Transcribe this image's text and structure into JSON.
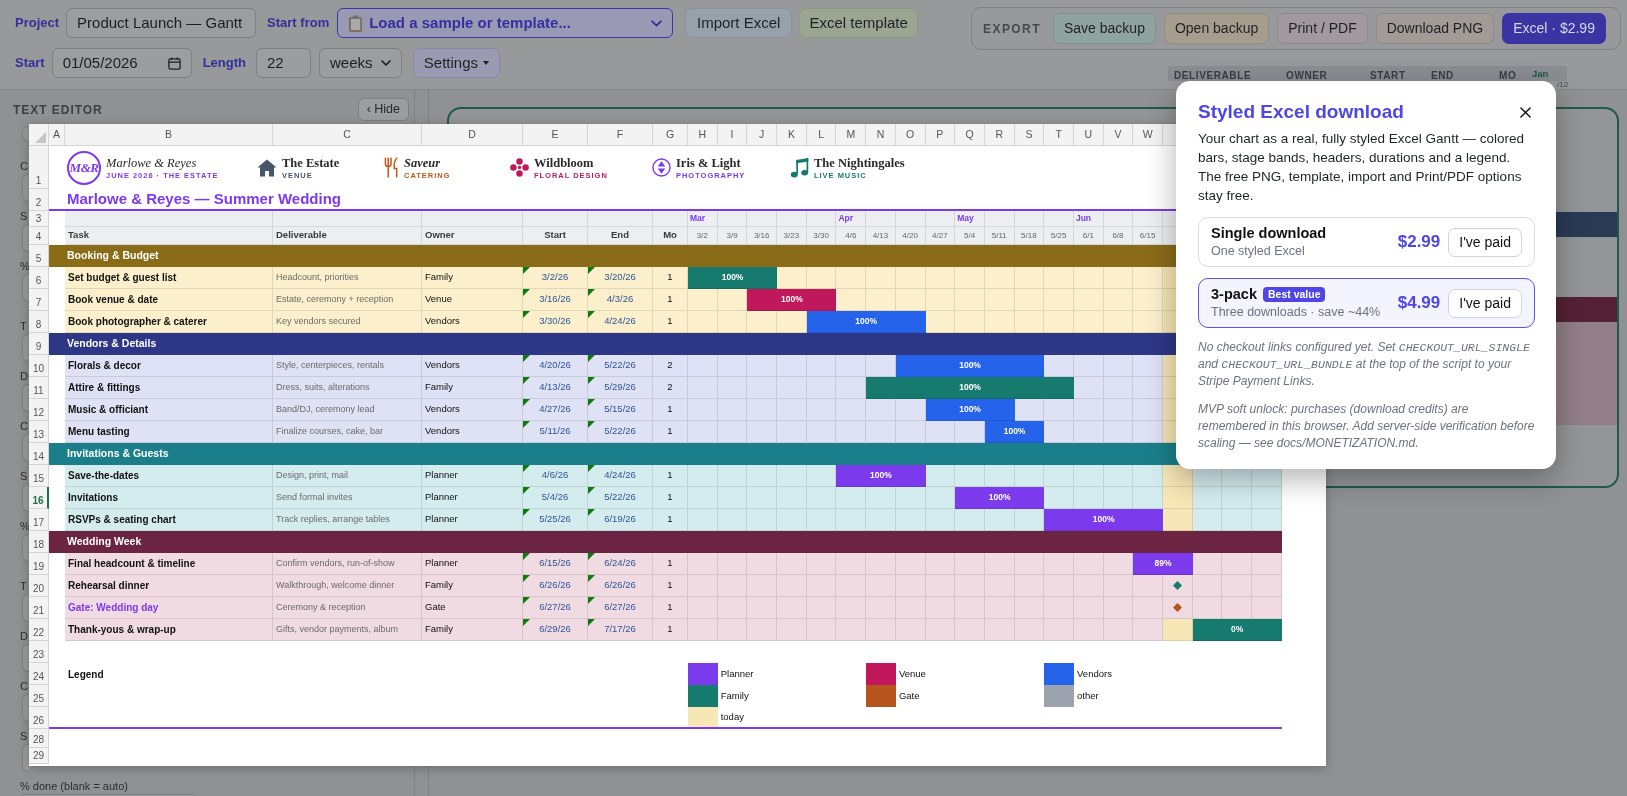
{
  "topbar": {
    "project_label": "Project",
    "project_name": "Product Launch — Gantt",
    "start_from_label": "Start from",
    "template_select": "Load a sample or template...",
    "import_button": "Import Excel",
    "template_button": "Excel template",
    "start_label": "Start",
    "start_date": "01/05/2026",
    "length_label": "Length",
    "length": "22",
    "unit": "weeks",
    "settings_button": "Settings"
  },
  "export": {
    "label": "EXPORT",
    "buttons": [
      {
        "label": "Save backup",
        "kind": "tint",
        "color": "#8fa4a0"
      },
      {
        "label": "Open backup",
        "kind": "tint",
        "color": "#a59e8f"
      },
      {
        "label": "Print / PDF",
        "kind": "tint",
        "color": "#a2999f"
      },
      {
        "label": "Download PNG",
        "kind": "tint",
        "color": "#a29a97"
      },
      {
        "label": "Excel · $2.99",
        "kind": "primary",
        "color": "#3b35a3"
      }
    ]
  },
  "editor": {
    "title": "TEXT EDITOR",
    "hide_button": "‹ Hide",
    "cards": [
      {
        "fields": [
          {
            "label": "C"
          },
          {
            "label": "S"
          },
          {
            "label": "%"
          }
        ]
      },
      {
        "fields": [
          {
            "label": "T"
          },
          {
            "label": "D"
          },
          {
            "label": "C"
          },
          {
            "label": "S"
          },
          {
            "label": "%"
          }
        ]
      },
      {
        "fields": [
          {
            "label": "T"
          },
          {
            "label": "D"
          },
          {
            "label": "C"
          },
          {
            "label": "S"
          },
          {
            "label": "% done (blank = auto)"
          }
        ]
      }
    ]
  },
  "table_header": {
    "columns": [
      "DELIVERABLE",
      "OWNER",
      "START",
      "END",
      "MO"
    ],
    "month": "Jan",
    "week": "/12"
  },
  "sheet": {
    "column_letters": [
      "A",
      "B",
      "C",
      "D",
      "E",
      "F",
      "G",
      "H",
      "I",
      "J",
      "K",
      "L",
      "M",
      "N",
      "O",
      "P",
      "Q",
      "R",
      "S",
      "T",
      "U",
      "V",
      "W"
    ],
    "row_numbers": [
      {
        "label": "1",
        "selected": false
      },
      {
        "label": "2",
        "selected": false
      },
      {
        "label": "3",
        "selected": false
      },
      {
        "label": "4",
        "selected": false
      },
      {
        "label": "5",
        "selected": false
      },
      {
        "label": "6",
        "selected": false
      },
      {
        "label": "7",
        "selected": false
      },
      {
        "label": "8",
        "selected": false
      },
      {
        "label": "9",
        "selected": false
      },
      {
        "label": "10",
        "selected": false
      },
      {
        "label": "11",
        "selected": false
      },
      {
        "label": "12",
        "selected": false
      },
      {
        "label": "13",
        "selected": false
      },
      {
        "label": "14",
        "selected": false
      },
      {
        "label": "15",
        "selected": false
      },
      {
        "label": "16",
        "selected": true
      },
      {
        "label": "17",
        "selected": false
      },
      {
        "label": "18",
        "selected": false
      },
      {
        "label": "19",
        "selected": false
      },
      {
        "label": "20",
        "selected": false
      },
      {
        "label": "21",
        "selected": false
      },
      {
        "label": "22",
        "selected": false
      },
      {
        "label": "23",
        "selected": false
      },
      {
        "label": "24",
        "selected": false
      },
      {
        "label": "25",
        "selected": false
      },
      {
        "label": "26",
        "selected": false
      },
      {
        "label": "28",
        "selected": false
      },
      {
        "label": "29",
        "selected": false
      }
    ],
    "logos": [
      {
        "kind": "monogram",
        "mark": "M&R",
        "name": "Marlowe & Reyes",
        "tagline": "JUNE 2026 · THE ESTATE",
        "color": "#7c3aed"
      },
      {
        "kind": "house",
        "name": "The Estate",
        "tagline": "VENUE",
        "color": "#475569"
      },
      {
        "kind": "cutlery",
        "name": "Saveur",
        "tagline": "CATERING",
        "color": "#c2571a"
      },
      {
        "kind": "flower",
        "name": "Wildbloom",
        "tagline": "FLORAL DESIGN",
        "color": "#c0185a"
      },
      {
        "kind": "aperture",
        "name": "Iris & Light",
        "tagline": "PHOTOGRAPHY",
        "color": "#7c3aed"
      },
      {
        "kind": "music",
        "name": "The Nightingales",
        "tagline": "LIVE MUSIC",
        "color": "#177a6e"
      }
    ],
    "title": "Marlowe & Reyes — Summer Wedding",
    "headers": [
      "Task",
      "Deliverable",
      "Owner",
      "Start",
      "End",
      "Mo"
    ],
    "weeks": [
      {
        "label": "3/2",
        "month": "Mar",
        "today": false
      },
      {
        "label": "3/9",
        "today": false
      },
      {
        "label": "3/16",
        "today": false
      },
      {
        "label": "3/23",
        "today": false
      },
      {
        "label": "3/30",
        "today": false
      },
      {
        "label": "4/6",
        "month": "Apr",
        "today": false
      },
      {
        "label": "4/13",
        "today": false
      },
      {
        "label": "4/20",
        "today": false
      },
      {
        "label": "4/27",
        "today": false
      },
      {
        "label": "5/4",
        "month": "May",
        "today": false
      },
      {
        "label": "5/11",
        "today": false
      },
      {
        "label": "5/18",
        "today": false
      },
      {
        "label": "5/25",
        "today": false
      },
      {
        "label": "6/1",
        "month": "Jun",
        "today": false
      },
      {
        "label": "6/8",
        "today": false
      },
      {
        "label": "6/15",
        "today": false
      },
      {
        "today": true
      }
    ],
    "stages": [
      {
        "name": "Booking & Budget",
        "color": "#8a6b18",
        "tint": {
          "color": "#fbf0cb"
        },
        "tasks": [
          {
            "kind": "task",
            "name": "Set budget & guest list",
            "deliverable": "Headcount, priorities",
            "owner": "Family",
            "start": "3/2/26",
            "end": "3/20/26",
            "months": "1",
            "progress": "100%",
            "color": "#177a6e"
          },
          {
            "kind": "task",
            "name": "Book venue & date",
            "deliverable": "Estate, ceremony + reception",
            "owner": "Venue",
            "start": "3/16/26",
            "end": "4/3/26",
            "months": "1",
            "progress": "100%",
            "color": "#c0185a"
          },
          {
            "kind": "task",
            "name": "Book photographer & caterer",
            "deliverable": "Key vendors secured",
            "owner": "Vendors",
            "start": "3/30/26",
            "end": "4/24/26",
            "months": "1",
            "progress": "100%",
            "color": "#2563eb"
          }
        ]
      },
      {
        "name": "Vendors & Details",
        "color": "#2e3786",
        "tint": {
          "color": "#dfe1f4"
        },
        "tasks": [
          {
            "kind": "task",
            "name": "Florals & decor",
            "deliverable": "Style, centerpieces, rentals",
            "owner": "Vendors",
            "start": "4/20/26",
            "end": "5/22/26",
            "months": "2",
            "progress": "100%",
            "color": "#2563eb"
          },
          {
            "kind": "task",
            "name": "Attire & fittings",
            "deliverable": "Dress, suits, alterations",
            "owner": "Family",
            "start": "4/13/26",
            "end": "5/29/26",
            "months": "2",
            "progress": "100%",
            "color": "#177a6e"
          },
          {
            "kind": "task",
            "name": "Music & officiant",
            "deliverable": "Band/DJ, ceremony lead",
            "owner": "Vendors",
            "start": "4/27/26",
            "end": "5/15/26",
            "months": "1",
            "progress": "100%",
            "color": "#2563eb"
          },
          {
            "kind": "task",
            "name": "Menu tasting",
            "deliverable": "Finalize courses, cake, bar",
            "owner": "Vendors",
            "start": "5/11/26",
            "end": "5/22/26",
            "months": "1",
            "progress": "100%",
            "color": "#2563eb"
          }
        ]
      },
      {
        "name": "Invitations & Guests",
        "color": "#1a7f8a",
        "tint": {
          "color": "#d5ecee"
        },
        "tasks": [
          {
            "kind": "task",
            "name": "Save-the-dates",
            "deliverable": "Design, print, mail",
            "owner": "Planner",
            "start": "4/6/26",
            "end": "4/24/26",
            "months": "1",
            "progress": "100%",
            "color": "#7c3aed"
          },
          {
            "kind": "task",
            "name": "Invitations",
            "deliverable": "Send formal invites",
            "owner": "Planner",
            "start": "5/4/26",
            "end": "5/22/26",
            "months": "1",
            "progress": "100%",
            "color": "#7c3aed"
          },
          {
            "kind": "task",
            "name": "RSVPs & seating chart",
            "deliverable": "Track replies, arrange tables",
            "owner": "Planner",
            "start": "5/25/26",
            "end": "6/19/26",
            "months": "1",
            "progress": "100%",
            "color": "#7c3aed"
          }
        ]
      },
      {
        "name": "Wedding Week",
        "color": "#6b2543",
        "tint": {
          "color": "#f1dbe3"
        },
        "tasks": [
          {
            "kind": "task",
            "name": "Final headcount & timeline",
            "deliverable": "Confirm vendors, run-of-show",
            "owner": "Planner",
            "start": "6/15/26",
            "end": "6/24/26",
            "months": "1",
            "progress": "89%",
            "color": "#7c3aed"
          },
          {
            "kind": "milestone",
            "name": "Rehearsal dinner",
            "deliverable": "Walkthrough, welcome dinner",
            "owner": "Family",
            "start": "6/26/26",
            "end": "6/26/26",
            "months": "1",
            "color": "#177a6e"
          },
          {
            "kind": "gate",
            "name": "Gate: Wedding day",
            "deliverable": "Ceremony & reception",
            "owner": "Gate",
            "start": "6/27/26",
            "end": "6/27/26",
            "months": "1",
            "color": "#b5541c"
          },
          {
            "kind": "task",
            "name": "Thank-yous & wrap-up",
            "deliverable": "Gifts, vendor payments, album",
            "owner": "Family",
            "start": "6/29/26",
            "end": "7/17/26",
            "months": "1",
            "progress": "0%",
            "color": "#177a6e"
          }
        ]
      }
    ],
    "legend": {
      "title": "Legend",
      "groups": [
        {
          "items": [
            {
              "label": "Planner",
              "color": "#7c3aed"
            },
            {
              "label": "Family",
              "color": "#177a6e"
            },
            {
              "label": "today",
              "color": "#f7e6b6"
            }
          ]
        },
        {
          "items": [
            {
              "label": "Venue",
              "color": "#c0185a"
            },
            {
              "label": "Gate",
              "color": "#b5541c"
            }
          ]
        },
        {
          "items": [
            {
              "label": "Vendors",
              "color": "#2563eb"
            },
            {
              "label": "other",
              "color": "#9ca3af"
            }
          ]
        }
      ]
    }
  },
  "modal": {
    "title": "Styled Excel download",
    "description": "Your chart as a real, fully styled Excel Gantt — colored bars, stage bands, headers, durations and a legend. The free PNG, template, import and Print/PDF options stay free.",
    "plans": [
      {
        "name": "Single download",
        "subtitle": "One styled Excel",
        "price": "$2.99",
        "button": "I've paid",
        "highlighted": false
      },
      {
        "name": "3-pack",
        "badge": "Best value",
        "subtitle": "Three downloads · save ~44%",
        "price": "$4.99",
        "button": "I've paid",
        "highlighted": true
      }
    ],
    "notes": [
      {
        "parts": [
          {
            "kind": "text",
            "text": "No checkout links configured yet. Set "
          },
          {
            "kind": "code",
            "text": "CHECKOUT_URL_SINGLE"
          },
          {
            "kind": "text",
            "text": " and "
          },
          {
            "kind": "code",
            "text": "CHECKOUT_URL_BUNDLE"
          },
          {
            "kind": "text",
            "text": " at the top of the script to your Stripe Payment Links."
          }
        ]
      },
      {
        "parts": [
          {
            "kind": "text",
            "text": "MVP soft unlock: purchases (download credits) are remembered in this browser. Add server-side verification before scaling — see docs/MONETIZATION.md."
          }
        ]
      }
    ]
  }
}
